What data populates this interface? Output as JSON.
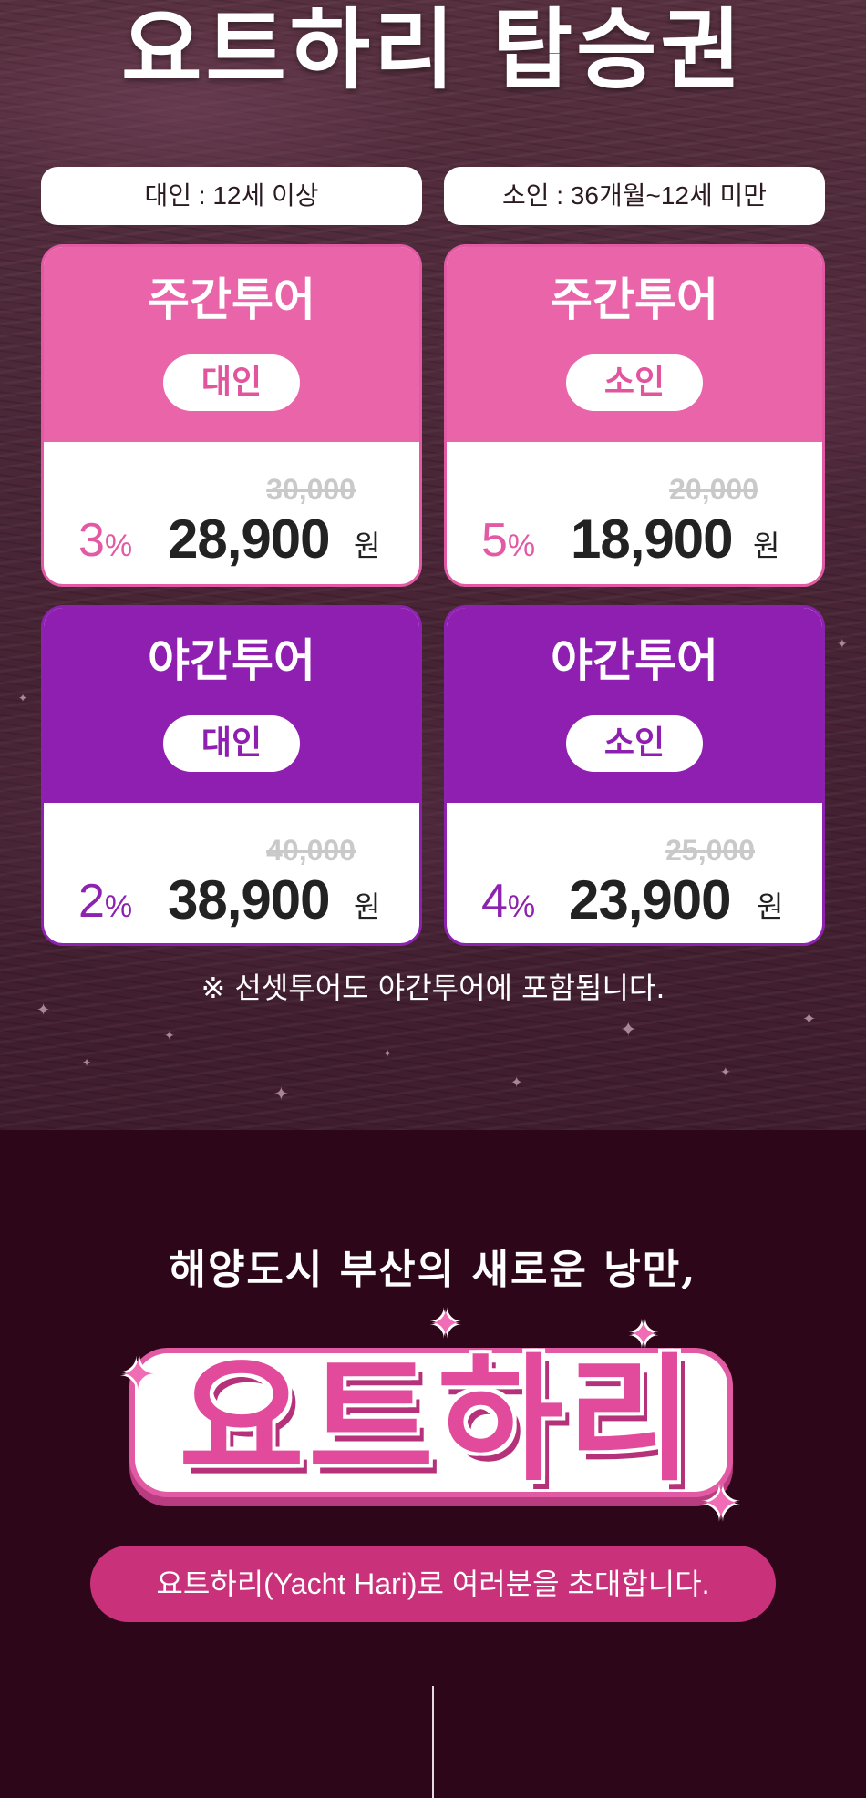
{
  "header": {
    "title": "요트하리 탑승권"
  },
  "categories": {
    "adult": "대인 : 12세 이상",
    "child": "소인 : 36개월~12세 미만"
  },
  "tickets": [
    {
      "tour": "주간투어",
      "age": "대인",
      "original_price": "30,000",
      "discount_value": "3",
      "discount_unit": "%",
      "price": "28,900",
      "currency": "원",
      "theme_color": "#e964a8"
    },
    {
      "tour": "주간투어",
      "age": "소인",
      "original_price": "20,000",
      "discount_value": "5",
      "discount_unit": "%",
      "price": "18,900",
      "currency": "원",
      "theme_color": "#e964a8"
    },
    {
      "tour": "야간투어",
      "age": "대인",
      "original_price": "40,000",
      "discount_value": "2",
      "discount_unit": "%",
      "price": "38,900",
      "currency": "원",
      "theme_color": "#8f1fb1"
    },
    {
      "tour": "야간투어",
      "age": "소인",
      "original_price": "25,000",
      "discount_value": "4",
      "discount_unit": "%",
      "price": "23,900",
      "currency": "원",
      "theme_color": "#8f1fb1"
    }
  ],
  "note": "※ 선셋투어도 야간투어에 포함됩니다.",
  "intro": {
    "tagline": "해양도시 부산의 새로운 낭만,",
    "logo_text": "요트하리",
    "invite": "요트하리(Yacht Hari)로 여러분을 초대합니다."
  },
  "colors": {
    "day_tour": "#e964a8",
    "night_tour": "#8f1fb1",
    "invite_pill": "#c9317a",
    "section_bg": "#2e0619"
  }
}
